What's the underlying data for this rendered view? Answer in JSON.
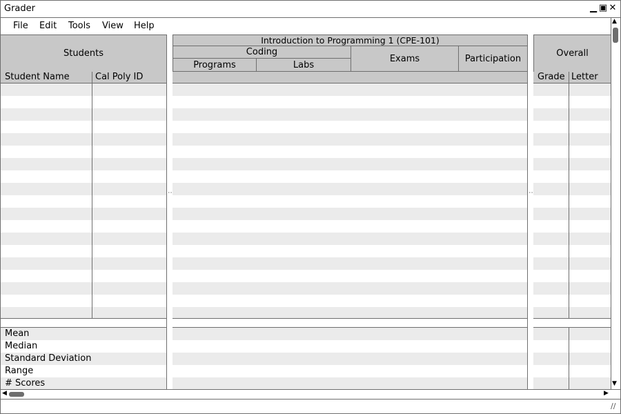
{
  "window": {
    "title": "Grader"
  },
  "menu": {
    "items": [
      "File",
      "Edit",
      "Tools",
      "View",
      "Help"
    ]
  },
  "students": {
    "header": "Students",
    "columns": [
      "Student Name",
      "Cal Poly ID"
    ],
    "stats_labels": [
      "Mean",
      "Median",
      "Standard Deviation",
      "Range",
      "# Scores"
    ]
  },
  "course": {
    "title": "Introduction to Programming 1 (CPE-101)",
    "coding": "Coding",
    "programs": "Programs",
    "labs": "Labs",
    "exams": "Exams",
    "participation": "Participation"
  },
  "overall": {
    "header": "Overall",
    "columns": [
      "Grade",
      "Letter"
    ]
  },
  "colors": {
    "header_bg": "#c8c8c8",
    "stripe": "#ebebeb",
    "border": "#6e6e6e"
  }
}
